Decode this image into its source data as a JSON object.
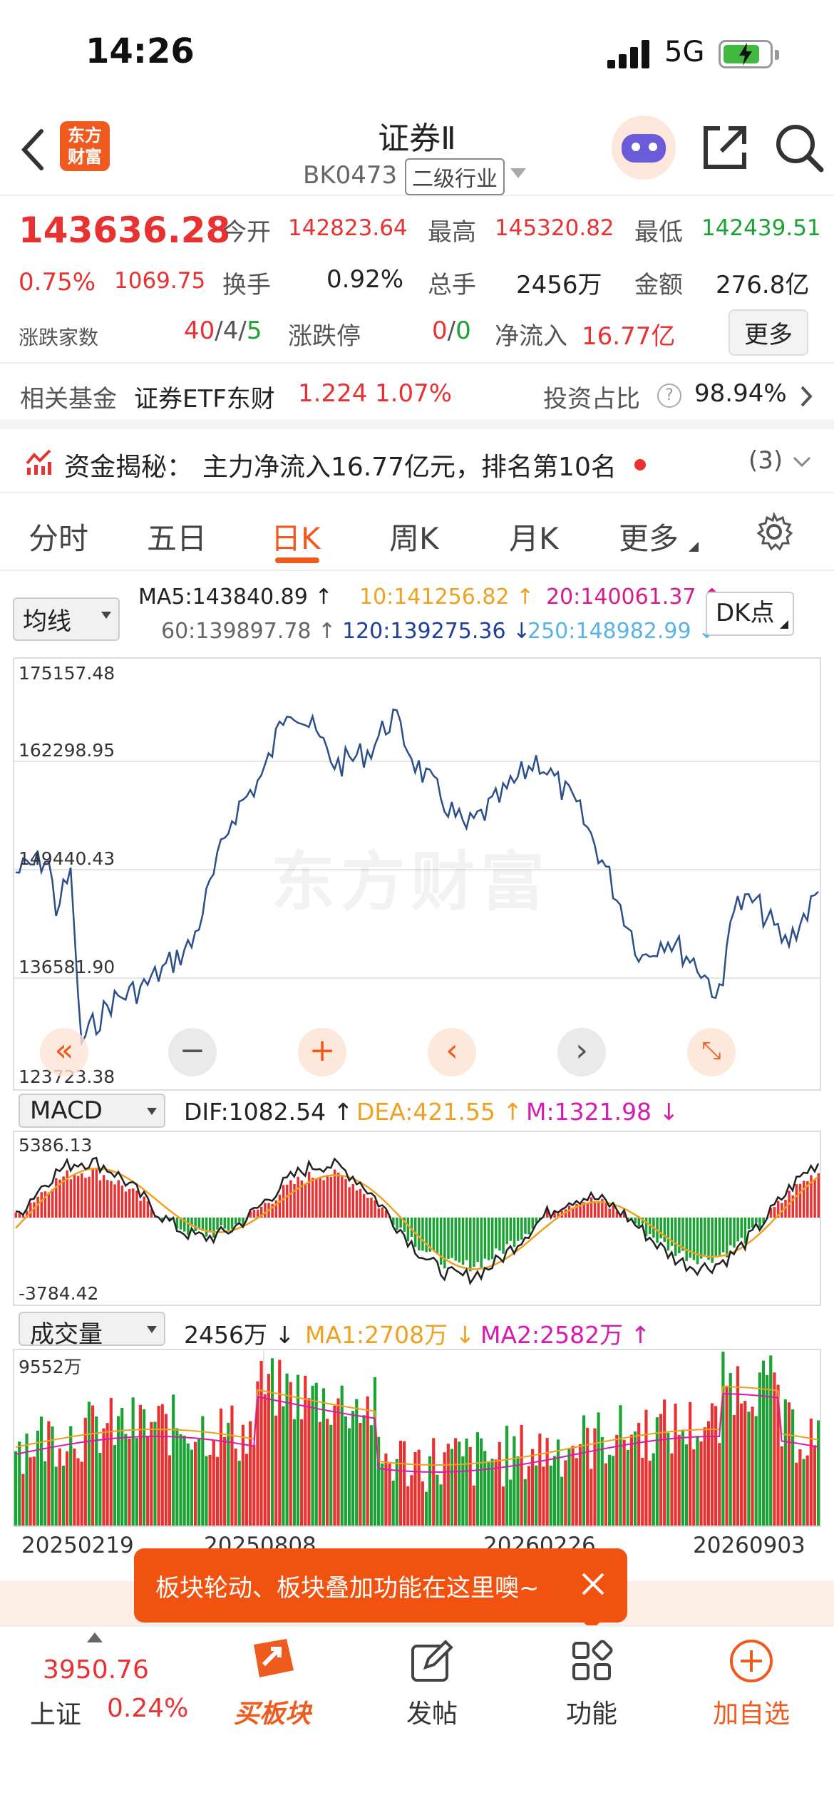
{
  "status_bar": {
    "time": "14:26",
    "network": "5G"
  },
  "header": {
    "title": "证券Ⅱ",
    "code": "BK0473",
    "tag": "二级行业",
    "logo_line1": "东方",
    "logo_line2": "财富"
  },
  "quote": {
    "price": "143636.28",
    "change_pct": "0.75%",
    "change": "1069.75",
    "open_label": "今开",
    "open": "142823.64",
    "high_label": "最高",
    "high": "145320.82",
    "low_label": "最低",
    "low": "142439.51",
    "turnover_label": "换手",
    "turnover": "0.92%",
    "volume_label": "总手",
    "volume": "2456万",
    "amount_label": "金额",
    "amount": "276.8亿",
    "breadth_label": "涨跌家数",
    "up": "40",
    "flat": "4",
    "down": "5",
    "limit_label": "涨跌停",
    "limit_up": "0",
    "limit_down": "0",
    "netflow_label": "净流入",
    "netflow": "16.77亿",
    "more": "更多"
  },
  "fund": {
    "label": "相关基金",
    "name": "证券ETF东财",
    "price": "1.224",
    "pct": "1.07%",
    "ratio_label": "投资占比",
    "ratio": "98.94%"
  },
  "secret": {
    "label": "资金揭秘：",
    "text": "主力净流入16.77亿元，排名第10名",
    "count": "(3)"
  },
  "tabs": [
    "分时",
    "五日",
    "日K",
    "周K",
    "月K",
    "更多"
  ],
  "ma": {
    "selector": "均线",
    "ma5": "MA5:143840.89",
    "ma10": "10:141256.82",
    "ma20": "20:140061.37",
    "ma60": "60:139897.78",
    "ma120": "120:139275.36",
    "ma250": "250:148982.99",
    "dk": "DK点"
  },
  "kline": {
    "y_labels": [
      "175157.48",
      "162298.95",
      "149440.43",
      "136581.90",
      "123723.38"
    ],
    "watermark": "东方财富"
  },
  "macd": {
    "selector": "MACD",
    "dif": "DIF:1082.54",
    "dea": "DEA:421.55",
    "m": "M:1321.98",
    "ymax": "5386.13",
    "ymin": "-3784.42"
  },
  "vol": {
    "selector": "成交量",
    "value": "2456万",
    "ma1": "MA1:2708万",
    "ma2": "MA2:2582万",
    "ymax": "9552万",
    "dates": [
      "20250219",
      "20250808",
      "20260226",
      "20260903"
    ]
  },
  "tip": {
    "text": "板块轮动、板块叠加功能在这里噢~"
  },
  "bottom": {
    "index_value": "3950.76",
    "index_name": "上证",
    "index_pct": "0.24%",
    "buy": "买板块",
    "post": "发帖",
    "func": "功能",
    "add": "加自选"
  },
  "colors": {
    "up": "#e83231",
    "down": "#1aa233",
    "accent": "#ef5b1f",
    "line": "#2c4f8c"
  }
}
